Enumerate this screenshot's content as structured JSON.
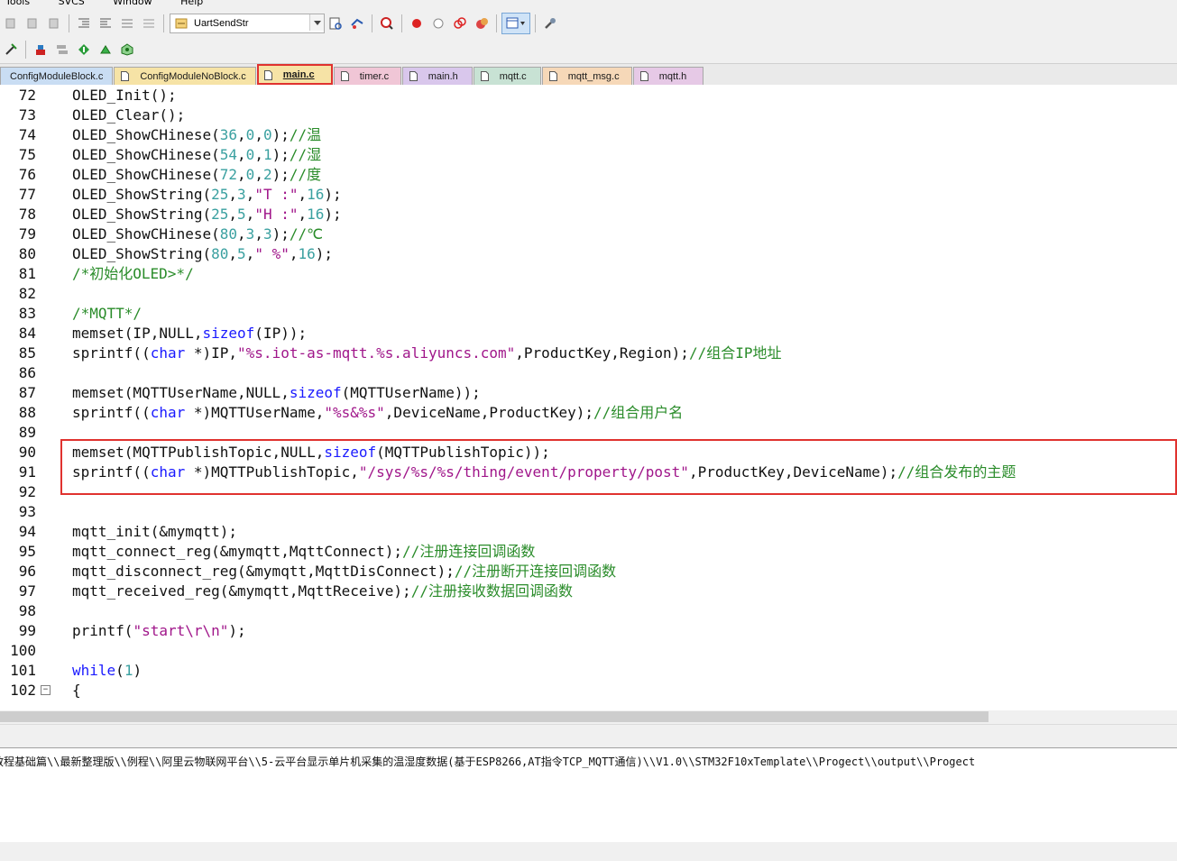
{
  "menu": [
    "Tools",
    "SVCS",
    "Window",
    "Help"
  ],
  "toolbar": {
    "target_combo": "UartSendStr"
  },
  "tabs": [
    {
      "label": "ConfigModuleBlock.c",
      "color": "#c9ddf3"
    },
    {
      "label": "ConfigModuleNoBlock.c",
      "color": "#f6e3a6"
    },
    {
      "label": "main.c",
      "color": "#f6e3a6",
      "active": true
    },
    {
      "label": "timer.c",
      "color": "#f0c6d6"
    },
    {
      "label": "main.h",
      "color": "#d9c7ec"
    },
    {
      "label": "mqtt.c",
      "color": "#c8e2d4"
    },
    {
      "label": "mqtt_msg.c",
      "color": "#f6d8b8"
    },
    {
      "label": "mqtt.h",
      "color": "#e6c9e6"
    }
  ],
  "editor": {
    "lines": [
      {
        "num": "72",
        "code": "OLED_Init();"
      },
      {
        "num": "73",
        "code": "OLED_Clear();"
      },
      {
        "num": "74",
        "code": "OLED_ShowCHinese(36,0,0);//温"
      },
      {
        "num": "75",
        "code": "OLED_ShowCHinese(54,0,1);//湿"
      },
      {
        "num": "76",
        "code": "OLED_ShowCHinese(72,0,2);//度"
      },
      {
        "num": "77",
        "code": "OLED_ShowString(25,3,\"T :\",16);"
      },
      {
        "num": "78",
        "code": "OLED_ShowString(25,5,\"H :\",16);"
      },
      {
        "num": "79",
        "code": "OLED_ShowCHinese(80,3,3);//℃"
      },
      {
        "num": "80",
        "code": "OLED_ShowString(80,5,\" %\",16);"
      },
      {
        "num": "81",
        "code": "/*初始化OLED>*/"
      },
      {
        "num": "82",
        "code": ""
      },
      {
        "num": "83",
        "code": "/*MQTT*/"
      },
      {
        "num": "84",
        "code": "memset(IP,NULL,sizeof(IP));"
      },
      {
        "num": "85",
        "code": "sprintf((char *)IP,\"%s.iot-as-mqtt.%s.aliyuncs.com\",ProductKey,Region);//组合IP地址"
      },
      {
        "num": "86",
        "code": ""
      },
      {
        "num": "87",
        "code": "memset(MQTTUserName,NULL,sizeof(MQTTUserName));"
      },
      {
        "num": "88",
        "code": "sprintf((char *)MQTTUserName,\"%s&%s\",DeviceName,ProductKey);//组合用户名"
      },
      {
        "num": "89",
        "code": ""
      },
      {
        "num": "90",
        "code": "memset(MQTTPublishTopic,NULL,sizeof(MQTTPublishTopic));"
      },
      {
        "num": "91",
        "code": "sprintf((char *)MQTTPublishTopic,\"/sys/%s/%s/thing/event/property/post\",ProductKey,DeviceName);//组合发布的主题"
      },
      {
        "num": "92",
        "code": ""
      },
      {
        "num": "93",
        "code": ""
      },
      {
        "num": "94",
        "code": "mqtt_init(&mymqtt);"
      },
      {
        "num": "95",
        "code": "mqtt_connect_reg(&mymqtt,MqttConnect);//注册连接回调函数"
      },
      {
        "num": "96",
        "code": "mqtt_disconnect_reg(&mymqtt,MqttDisConnect);//注册断开连接回调函数"
      },
      {
        "num": "97",
        "code": "mqtt_received_reg(&mymqtt,MqttReceive);//注册接收数据回调函数"
      },
      {
        "num": "98",
        "code": ""
      },
      {
        "num": "99",
        "code": "printf(\"start\\r\\n\");"
      },
      {
        "num": "100",
        "code": ""
      },
      {
        "num": "101",
        "code": "while(1)"
      },
      {
        "num": "102",
        "code": "{"
      }
    ]
  },
  "output": {
    "text": "教程基础篇\\\\最新整理版\\\\例程\\\\阿里云物联网平台\\\\5-云平台显示单片机采集的温湿度数据(基于ESP8266,AT指令TCP_MQTT通信)\\\\V1.0\\\\STM32F10xTemplate\\\\Progect\\\\output\\\\Progect"
  },
  "colors": {
    "keyword": "#1a1aff",
    "string": "#a0168a",
    "comment": "#2a8c2a",
    "highlight_border": "#e0322f"
  }
}
